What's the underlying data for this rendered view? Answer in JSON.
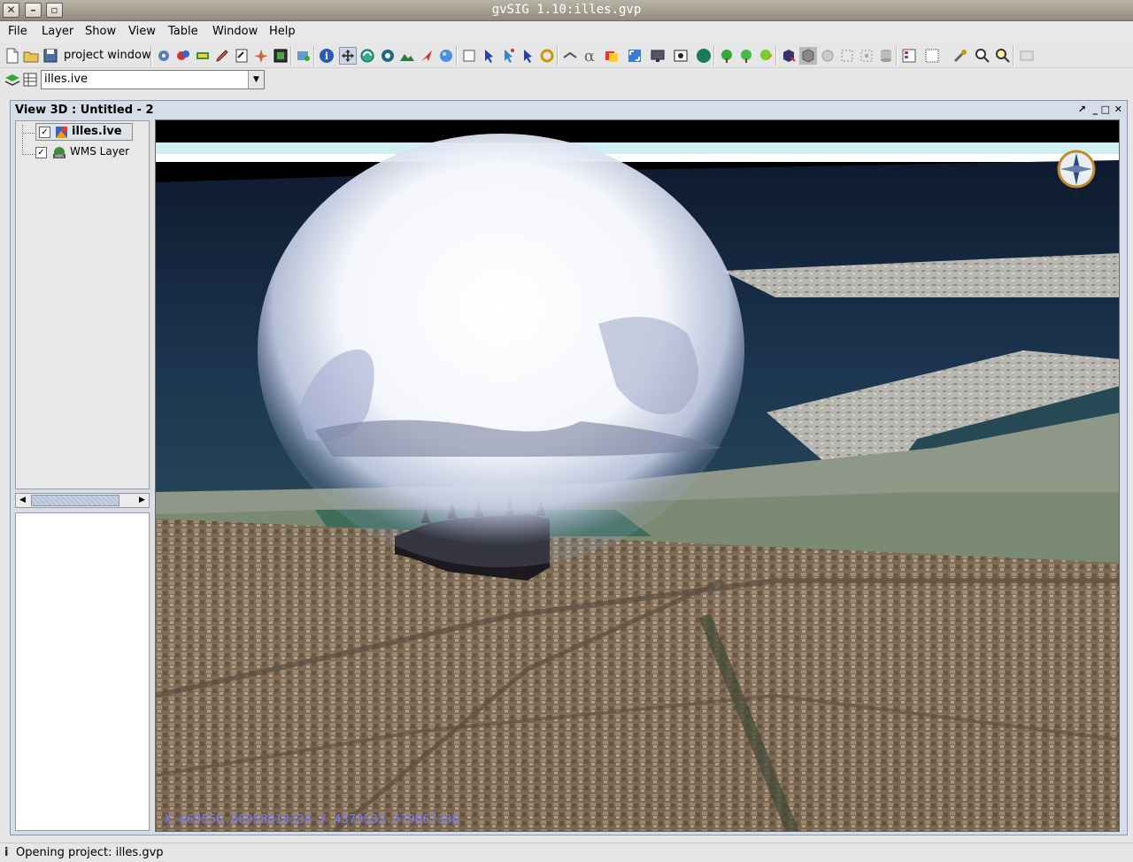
{
  "window": {
    "title": "gvSIG 1.10:illes.gvp"
  },
  "menubar": {
    "items": [
      {
        "label": "File"
      },
      {
        "label": "Layer"
      },
      {
        "label": "Show"
      },
      {
        "label": "View"
      },
      {
        "label": "Table"
      },
      {
        "label": "Window"
      },
      {
        "label": "Help"
      }
    ]
  },
  "toolbar": {
    "project_window_label": "project window"
  },
  "layer_selector": {
    "value": "illes.ive"
  },
  "view": {
    "title": "View 3D : Untitled - 2",
    "toc": [
      {
        "label": "illes.ive",
        "checked": true,
        "selected": true
      },
      {
        "label": "WMS Layer",
        "checked": true,
        "selected": false
      }
    ],
    "coords_text": "X  469556.60958018334 Y  4379533.679867388"
  },
  "status": {
    "message": "Opening project: illes.gvp",
    "icon": "info-icon"
  },
  "colors": {
    "coord_text": "#7c7cff",
    "title_bar": "#a8a295",
    "frame_border": "#8a96ad"
  }
}
